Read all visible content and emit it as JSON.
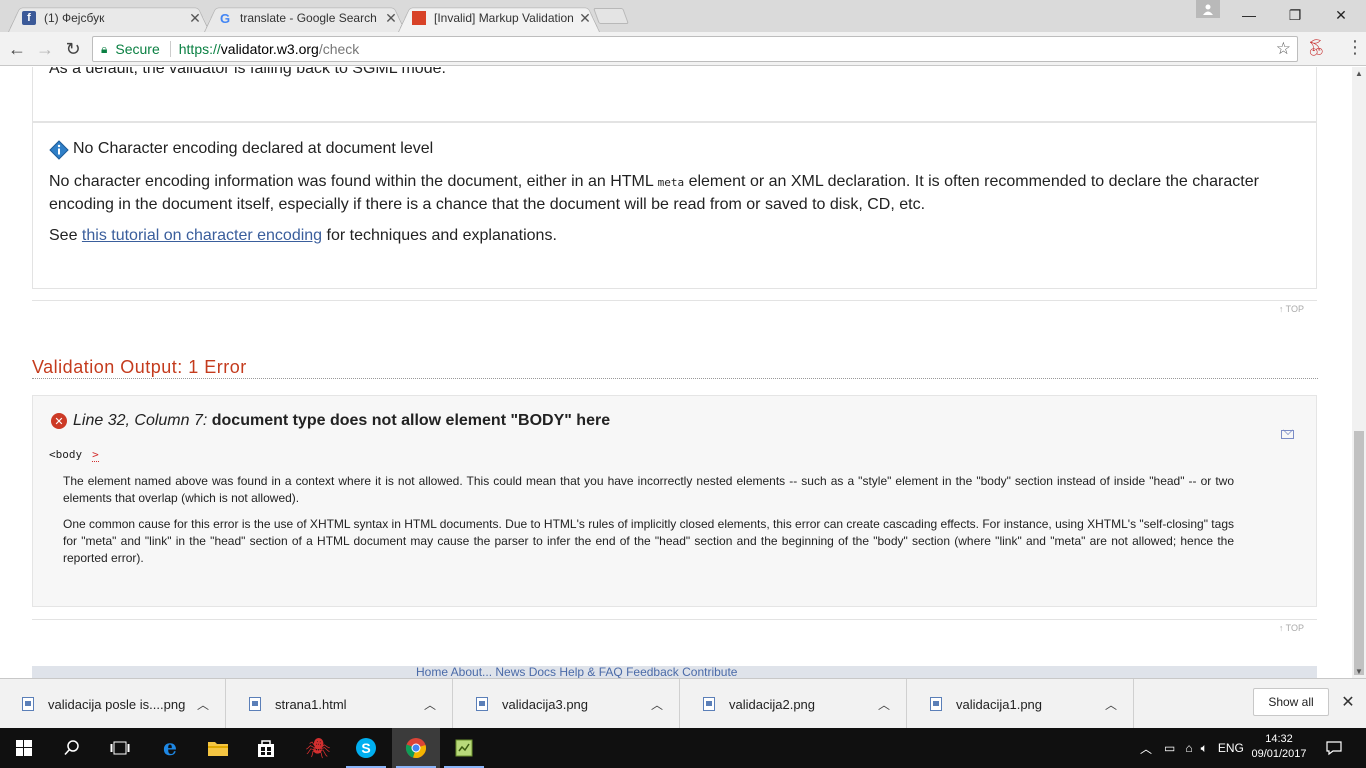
{
  "browser": {
    "tabs": [
      {
        "title": "(1) Фејсбук",
        "favicon": "facebook-icon",
        "color": "#3b5998",
        "active": false
      },
      {
        "title": "translate - Google Search",
        "favicon": "google-icon",
        "color": "#4285f4",
        "active": false
      },
      {
        "title": "[Invalid] Markup Validation",
        "favicon": "w3c-icon",
        "color": "#d84227",
        "active": true
      }
    ],
    "secure_label": "Secure",
    "url_scheme": "https://",
    "url_host": "validator.w3.org",
    "url_path": "/check"
  },
  "page": {
    "cut_text": "As a default, the validator is falling back to SGML mode.",
    "info": {
      "title": "No Character encoding declared at document level",
      "p1_a": "No character encoding information was found within the document, either in an HTML ",
      "p1_code": "meta",
      "p1_b": " element or an XML declaration. It is often recommended to declare the character encoding in the document itself, especially if there is a chance that the document will be read from or saved to disk, CD, etc.",
      "p2_a": "See ",
      "p2_link": "this tutorial on character encoding",
      "p2_b": " for techniques and explanations."
    },
    "top_label": "↑ TOP",
    "section_title": "Validation Output: 1 Error",
    "error": {
      "location": "Line 32, Column 7",
      "message": "document type does not allow element \"BODY\" here",
      "code": "<body",
      "code_marker": ">",
      "p1": "The element named above was found in a context where it is not allowed. This could mean that you have incorrectly nested elements -- such as a \"style\" element in the \"body\" section instead of inside \"head\" -- or two elements that overlap (which is not allowed).",
      "p2": "One common cause for this error is the use of XHTML syntax in HTML documents. Due to HTML's rules of implicitly closed elements, this error can create cascading effects. For instance, using XHTML's \"self-closing\" tags for \"meta\" and \"link\" in the \"head\" section of a HTML document may cause the parser to infer the end of the \"head\" section and the beginning of the \"body\" section (where \"link\" and \"meta\" are not allowed; hence the reported error)."
    },
    "footer_links": "Home    About...    News    Docs    Help & FAQ    Feedback    Contribute"
  },
  "downloads": {
    "items": [
      {
        "name": "validacija posle is....png"
      },
      {
        "name": "strana1.html"
      },
      {
        "name": "validacija3.png"
      },
      {
        "name": "validacija2.png"
      },
      {
        "name": "validacija1.png"
      }
    ],
    "show_all": "Show all"
  },
  "taskbar": {
    "language": "ENG",
    "time": "14:32",
    "date": "09/01/2017"
  }
}
